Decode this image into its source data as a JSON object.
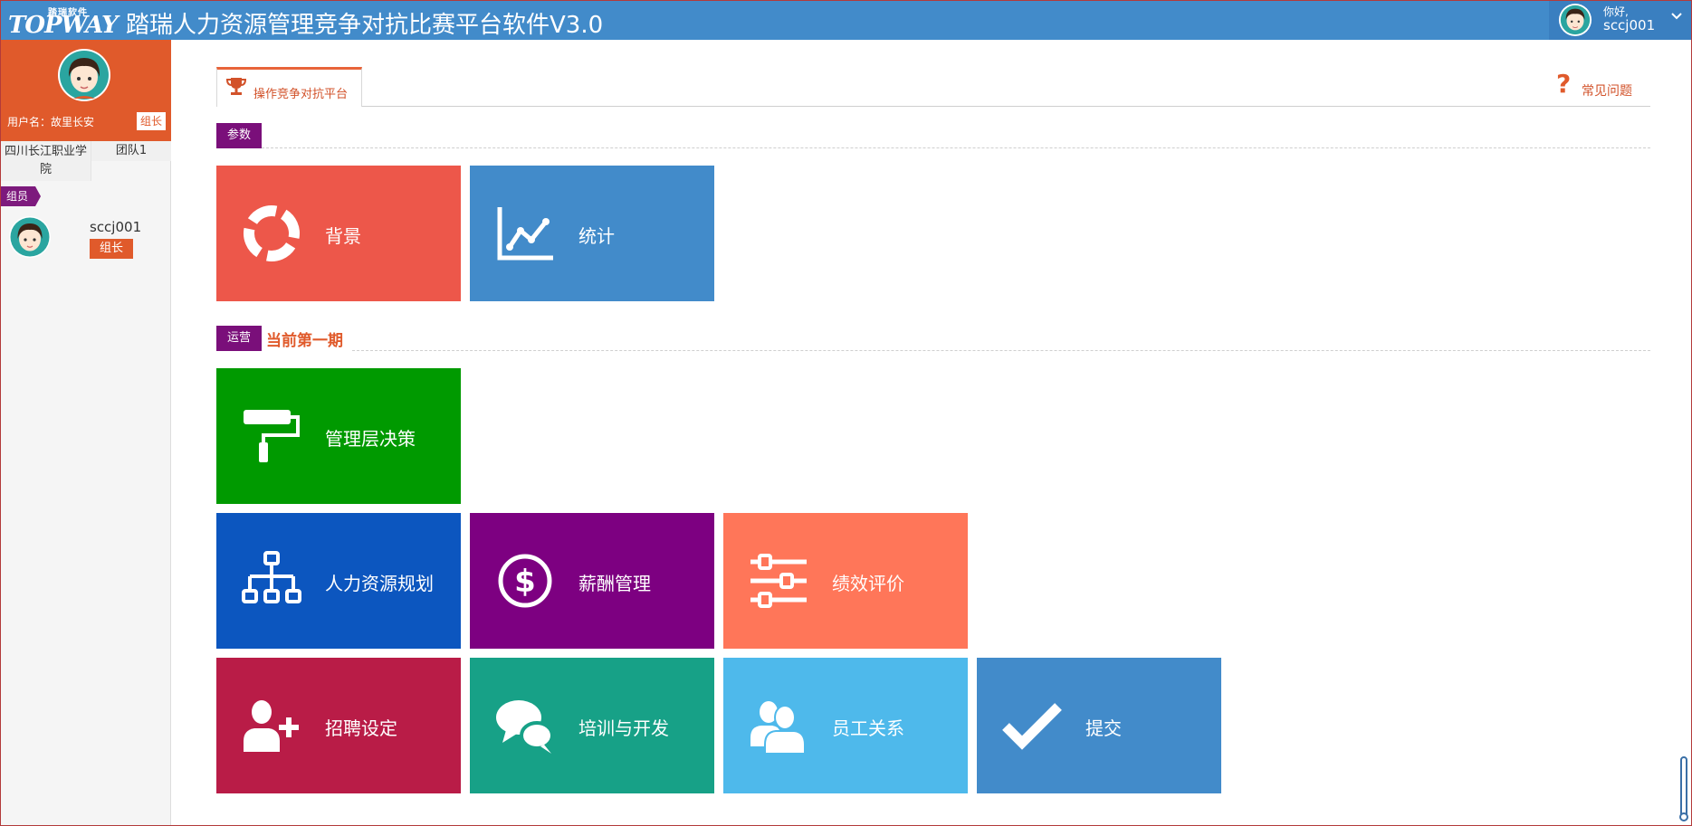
{
  "topbar": {
    "logo_small": "踏瑞软件",
    "logo_main": "TOPWAY",
    "title": "踏瑞人力资源管理竞争对抗比赛平台软件V3.0",
    "greeting": "你好,",
    "username": "sccj001"
  },
  "sidebar": {
    "username_label": "用户名：故里长安",
    "role": "组长",
    "school": "四川长江职业学院",
    "team": "团队1",
    "members_label": "组员",
    "members": [
      {
        "name": "sccj001",
        "role": "组长"
      }
    ]
  },
  "main": {
    "active_tab": "操作竞争对抗平台",
    "faq": "常见问题",
    "sections": {
      "params": {
        "badge": "参数"
      },
      "ops": {
        "badge": "运营",
        "period": "当前第一期"
      }
    },
    "tiles": [
      {
        "label": "背景",
        "icon": "life-ring-icon",
        "color": "#ed574a"
      },
      {
        "label": "统计",
        "icon": "line-chart-icon",
        "color": "#428bca"
      },
      {
        "label": "管理层决策",
        "icon": "paint-roller-icon",
        "color": "#009a00"
      },
      {
        "label": "人力资源规划",
        "icon": "sitemap-icon",
        "color": "#0c56bf"
      },
      {
        "label": "薪酬管理",
        "icon": "dollar-circle-icon",
        "color": "#7d0081"
      },
      {
        "label": "绩效评价",
        "icon": "sliders-icon",
        "color": "#ff7659"
      },
      {
        "label": "招聘设定",
        "icon": "user-add-icon",
        "color": "#b91c47"
      },
      {
        "label": "培训与开发",
        "icon": "chat-bubbles-icon",
        "color": "#17a187"
      },
      {
        "label": "员工关系",
        "icon": "users-icon",
        "color": "#4eb9eb"
      },
      {
        "label": "提交",
        "icon": "checkmark-icon",
        "color": "#428bca"
      }
    ]
  }
}
